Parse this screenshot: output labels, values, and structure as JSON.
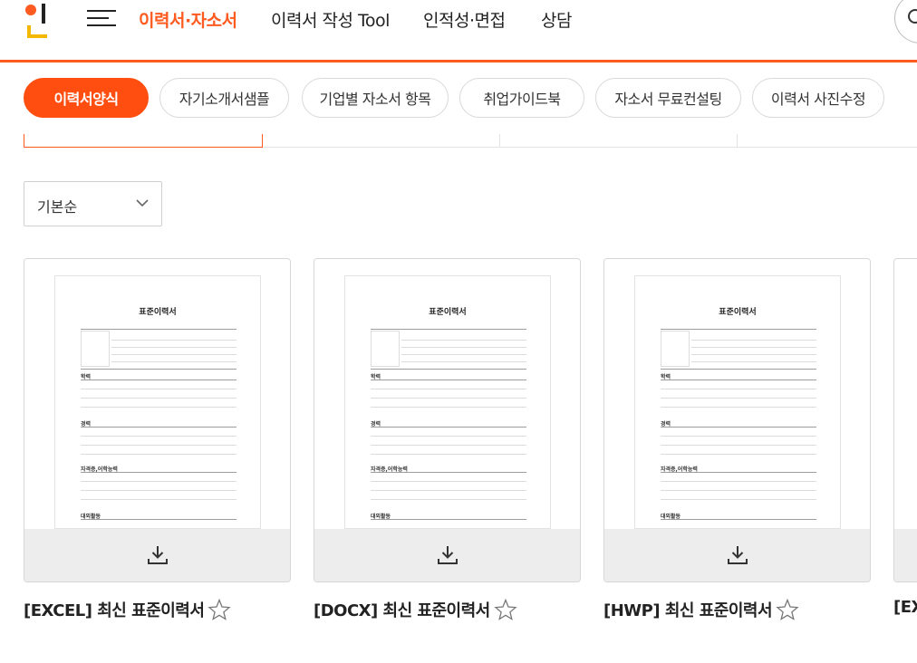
{
  "header": {
    "nav": [
      "이력서·자소서",
      "이력서 작성 Tool",
      "인적성·면접",
      "상담"
    ],
    "active_nav": 0,
    "colors": {
      "accent": "#ff5a1f"
    }
  },
  "chips": [
    "이력서양식",
    "자기소개서샘플",
    "기업별 자소서 항목",
    "취업가이드북",
    "자소서 무료컨설팅",
    "이력서 사진수정"
  ],
  "sort": {
    "selected": "기본순"
  },
  "cards": [
    {
      "title": "[EXCEL] 최신 표준이력서",
      "doc_title": "표준이력서",
      "download_icon": "download-icon",
      "favorite_icon": "star-outline-icon"
    },
    {
      "title": "[DOCX] 최신 표준이력서",
      "doc_title": "표준이력서",
      "download_icon": "download-icon",
      "favorite_icon": "star-outline-icon"
    },
    {
      "title": "[HWP] 최신 표준이력서",
      "doc_title": "표준이력서",
      "download_icon": "download-icon",
      "favorite_icon": "star-outline-icon"
    },
    {
      "title": "[EX",
      "partial": true
    }
  ]
}
